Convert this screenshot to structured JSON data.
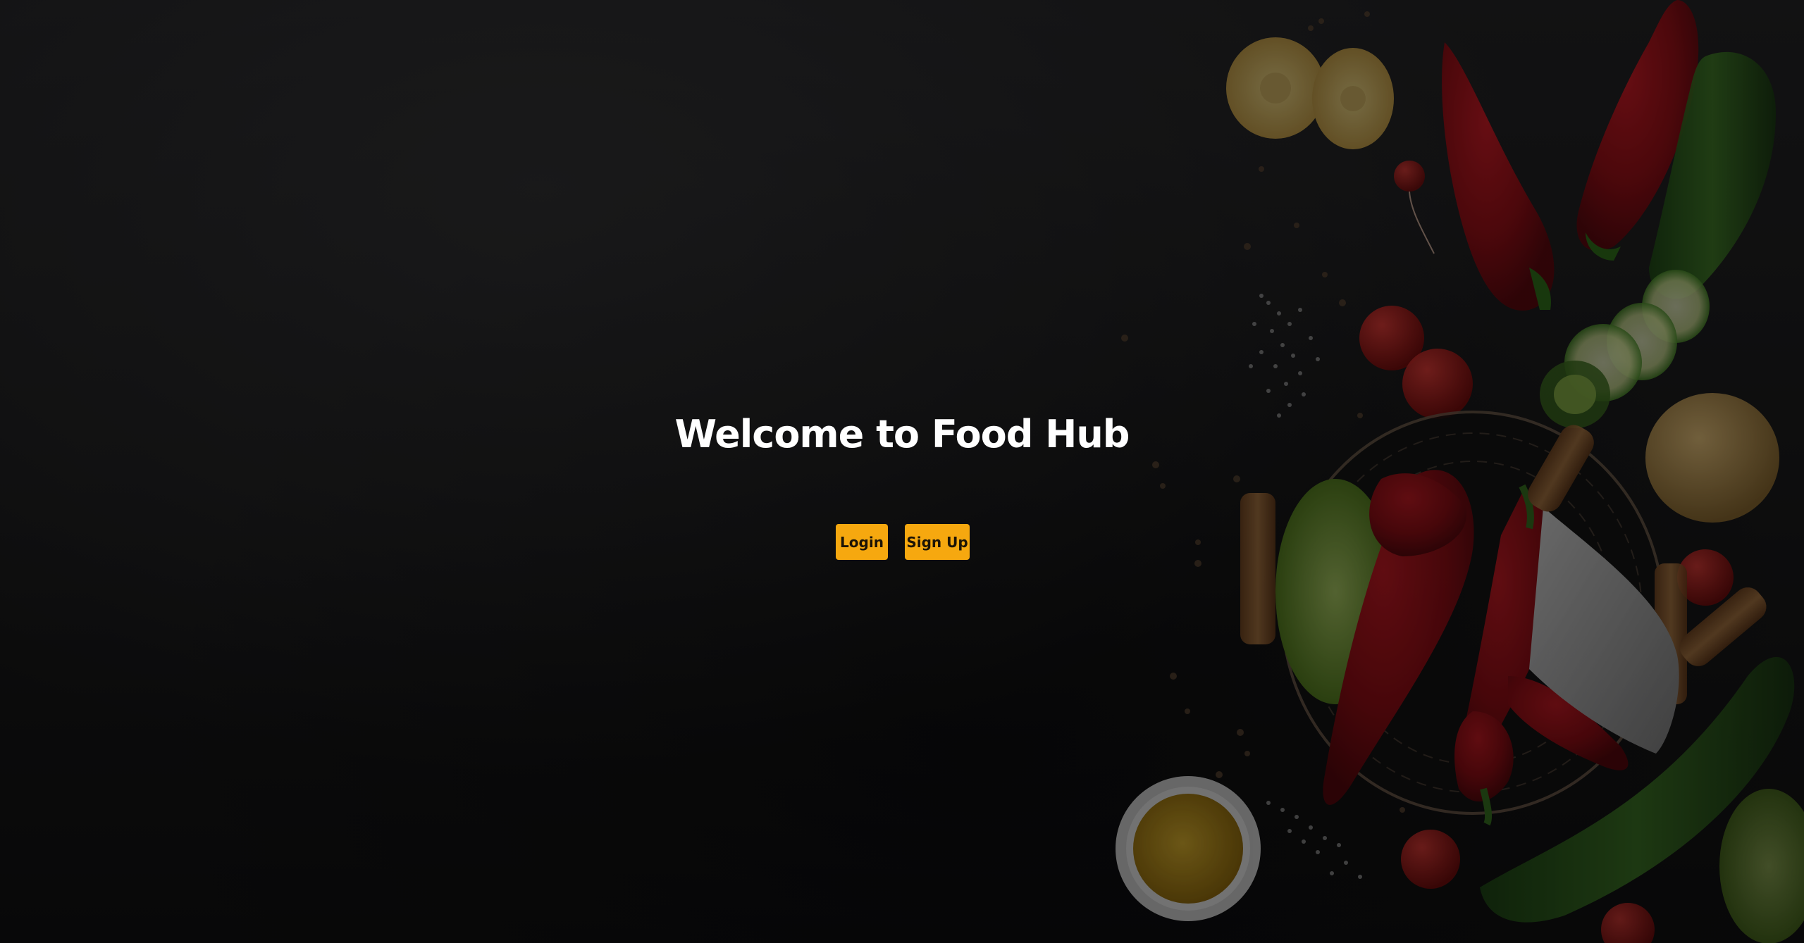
{
  "hero": {
    "title": "Welcome to Food Hub"
  },
  "actions": {
    "login_label": "Login",
    "signup_label": "Sign Up"
  },
  "colors": {
    "background": "#1a1a1b",
    "button": "#f6a80f",
    "title": "#ffffff"
  },
  "background_image": {
    "subject": "vegetables-on-dark-slate"
  }
}
